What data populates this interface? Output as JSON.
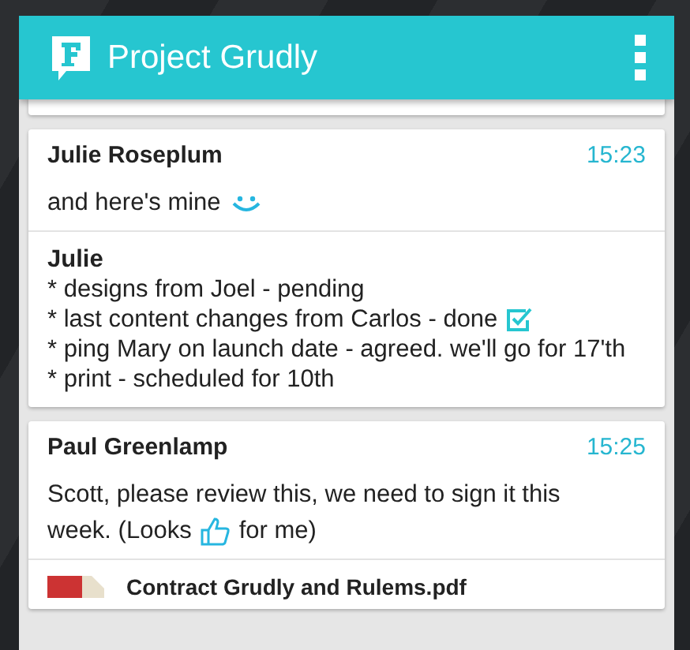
{
  "app_bar": {
    "title": "Project Grudly"
  },
  "messages": [
    {
      "author": "Julie Roseplum",
      "time": "15:23",
      "body": [
        [
          {
            "kind": "text",
            "text": "and here's mine"
          },
          {
            "kind": "smiley"
          }
        ]
      ],
      "note": {
        "title": "Julie",
        "lines": [
          {
            "text": "* designs from Joel - pending",
            "done": false
          },
          {
            "text": "* last content changes from Carlos - done",
            "done": true
          },
          {
            "text": "* ping Mary on launch date - agreed. we'll go for 17'th",
            "done": false
          },
          {
            "text": "* print - scheduled for 10th",
            "done": false
          }
        ]
      }
    },
    {
      "author": "Paul Greenlamp",
      "time": "15:25",
      "body": [
        [
          {
            "kind": "text",
            "text": "Scott, please review this, we need to sign it this"
          }
        ],
        [
          {
            "kind": "text",
            "text": "week. (Looks"
          },
          {
            "kind": "thumbs-up"
          },
          {
            "kind": "text",
            "text": "for me)"
          }
        ]
      ],
      "attachment": {
        "name": "Contract Grudly and Rulems.pdf"
      }
    }
  ]
}
